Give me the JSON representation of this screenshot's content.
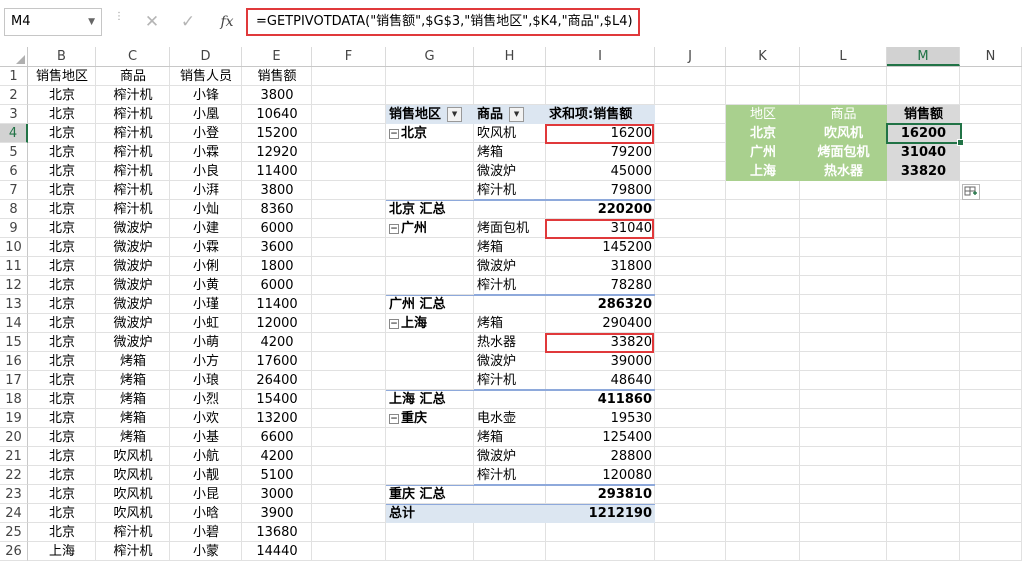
{
  "formula_bar": {
    "name_box": "M4",
    "formula": "=GETPIVOTDATA(\"销售额\",$G$3,\"销售地区\",$K4,\"商品\",$L4)",
    "cancel_icon": "✕",
    "enter_icon": "✓",
    "fx_label": "fx"
  },
  "columns": [
    "B",
    "C",
    "D",
    "E",
    "F",
    "G",
    "H",
    "I",
    "J",
    "K",
    "L",
    "M",
    "N"
  ],
  "rows": [
    "1",
    "2",
    "3",
    "4",
    "5",
    "6",
    "7",
    "8",
    "9",
    "10",
    "11",
    "12",
    "13",
    "14",
    "15",
    "16",
    "17",
    "18",
    "19",
    "20",
    "21",
    "22",
    "23",
    "24",
    "25",
    "26"
  ],
  "source_table": {
    "headers": [
      "销售地区",
      "商品",
      "销售人员",
      "销售额"
    ],
    "rows": [
      [
        "北京",
        "榨汁机",
        "小锋",
        "3800"
      ],
      [
        "北京",
        "榨汁机",
        "小凰",
        "10640"
      ],
      [
        "北京",
        "榨汁机",
        "小登",
        "15200"
      ],
      [
        "北京",
        "榨汁机",
        "小霖",
        "12920"
      ],
      [
        "北京",
        "榨汁机",
        "小良",
        "11400"
      ],
      [
        "北京",
        "榨汁机",
        "小湃",
        "3800"
      ],
      [
        "北京",
        "榨汁机",
        "小灿",
        "8360"
      ],
      [
        "北京",
        "微波炉",
        "小建",
        "6000"
      ],
      [
        "北京",
        "微波炉",
        "小霖",
        "3600"
      ],
      [
        "北京",
        "微波炉",
        "小俐",
        "1800"
      ],
      [
        "北京",
        "微波炉",
        "小黄",
        "6000"
      ],
      [
        "北京",
        "微波炉",
        "小瑾",
        "11400"
      ],
      [
        "北京",
        "微波炉",
        "小虹",
        "12000"
      ],
      [
        "北京",
        "微波炉",
        "小萌",
        "4200"
      ],
      [
        "北京",
        "烤箱",
        "小方",
        "17600"
      ],
      [
        "北京",
        "烤箱",
        "小琅",
        "26400"
      ],
      [
        "北京",
        "烤箱",
        "小烈",
        "15400"
      ],
      [
        "北京",
        "烤箱",
        "小欢",
        "13200"
      ],
      [
        "北京",
        "烤箱",
        "小基",
        "6600"
      ],
      [
        "北京",
        "吹风机",
        "小航",
        "4200"
      ],
      [
        "北京",
        "吹风机",
        "小靓",
        "5100"
      ],
      [
        "北京",
        "吹风机",
        "小昆",
        "3000"
      ],
      [
        "北京",
        "吹风机",
        "小晗",
        "3900"
      ],
      [
        "北京",
        "榨汁机",
        "小碧",
        "13680"
      ],
      [
        "上海",
        "榨汁机",
        "小蒙",
        "14440"
      ]
    ]
  },
  "pivot": {
    "headers": [
      "销售地区",
      "商品",
      "求和项:销售额"
    ],
    "rows": [
      {
        "region": "北京",
        "product": "吹风机",
        "value": "16200",
        "kind": "group"
      },
      {
        "region": "",
        "product": "烤箱",
        "value": "79200",
        "kind": "item"
      },
      {
        "region": "",
        "product": "微波炉",
        "value": "45000",
        "kind": "item"
      },
      {
        "region": "",
        "product": "榨汁机",
        "value": "79800",
        "kind": "item"
      },
      {
        "region": "北京 汇总",
        "product": "",
        "value": "220200",
        "kind": "subtotal"
      },
      {
        "region": "广州",
        "product": "烤面包机",
        "value": "31040",
        "kind": "group"
      },
      {
        "region": "",
        "product": "烤箱",
        "value": "145200",
        "kind": "item"
      },
      {
        "region": "",
        "product": "微波炉",
        "value": "31800",
        "kind": "item"
      },
      {
        "region": "",
        "product": "榨汁机",
        "value": "78280",
        "kind": "item"
      },
      {
        "region": "广州 汇总",
        "product": "",
        "value": "286320",
        "kind": "subtotal"
      },
      {
        "region": "上海",
        "product": "烤箱",
        "value": "290400",
        "kind": "group"
      },
      {
        "region": "",
        "product": "热水器",
        "value": "33820",
        "kind": "item"
      },
      {
        "region": "",
        "product": "微波炉",
        "value": "39000",
        "kind": "item"
      },
      {
        "region": "",
        "product": "榨汁机",
        "value": "48640",
        "kind": "item"
      },
      {
        "region": "上海 汇总",
        "product": "",
        "value": "411860",
        "kind": "subtotal"
      },
      {
        "region": "重庆",
        "product": "电水壶",
        "value": "19530",
        "kind": "group"
      },
      {
        "region": "",
        "product": "烤箱",
        "value": "125400",
        "kind": "item"
      },
      {
        "region": "",
        "product": "微波炉",
        "value": "28800",
        "kind": "item"
      },
      {
        "region": "",
        "product": "榨汁机",
        "value": "120080",
        "kind": "item"
      },
      {
        "region": "重庆 汇总",
        "product": "",
        "value": "293810",
        "kind": "subtotal"
      },
      {
        "region": "总计",
        "product": "",
        "value": "1212190",
        "kind": "total"
      }
    ]
  },
  "lookup_table": {
    "headers": [
      "地区",
      "商品",
      "销售额"
    ],
    "rows": [
      [
        "北京",
        "吹风机",
        "16200"
      ],
      [
        "广州",
        "烤面包机",
        "31040"
      ],
      [
        "上海",
        "热水器",
        "33820"
      ]
    ]
  },
  "colors": {
    "accent_green": "#217346",
    "highlight_red": "#e0393b",
    "lookup_header_green": "#a9d08e",
    "pivot_header_blue": "#dce6f1"
  }
}
